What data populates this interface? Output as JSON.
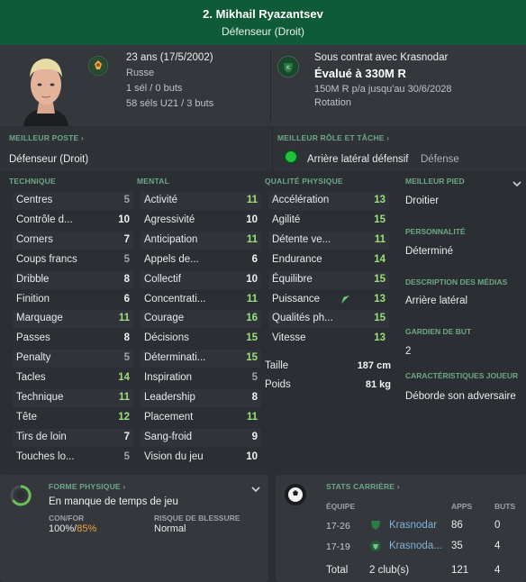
{
  "header": {
    "name": "2. Mikhail Ryazantsev",
    "position": "Défenseur (Droit)"
  },
  "bio": {
    "age": "23 ans (17/5/2002)",
    "nationality": "Russe",
    "caps": "1 sél / 0 buts",
    "u21_caps": "58 séls U21 / 3 buts",
    "contract": "Sous contrat avec Krasnodar",
    "value": "Évalué à 330M R",
    "wage": "150M R p/a jusqu'au 30/6/2028",
    "squad_status": "Rotation"
  },
  "best_position": {
    "label": "MEILLEUR POSTE",
    "value": "Défenseur (Droit)"
  },
  "best_role": {
    "label": "MEILLEUR RÔLE ET TÂCHE",
    "role": "Arrière latéral défensif",
    "duty": "Défense"
  },
  "technique": {
    "label": "TECHNIQUE",
    "items": [
      {
        "name": "Centres",
        "value": "5"
      },
      {
        "name": "Contrôle d...",
        "value": "10"
      },
      {
        "name": "Corners",
        "value": "7"
      },
      {
        "name": "Coups francs",
        "value": "5"
      },
      {
        "name": "Dribble",
        "value": "8"
      },
      {
        "name": "Finition",
        "value": "6"
      },
      {
        "name": "Marquage",
        "value": "11"
      },
      {
        "name": "Passes",
        "value": "8"
      },
      {
        "name": "Penalty",
        "value": "5"
      },
      {
        "name": "Tacles",
        "value": "14"
      },
      {
        "name": "Technique",
        "value": "11"
      },
      {
        "name": "Tête",
        "value": "12"
      },
      {
        "name": "Tirs de loin",
        "value": "7"
      },
      {
        "name": "Touches lo...",
        "value": "5"
      }
    ]
  },
  "mental": {
    "label": "MENTAL",
    "items": [
      {
        "name": "Activité",
        "value": "11"
      },
      {
        "name": "Agressivité",
        "value": "10"
      },
      {
        "name": "Anticipation",
        "value": "11"
      },
      {
        "name": "Appels de...",
        "value": "6"
      },
      {
        "name": "Collectif",
        "value": "10"
      },
      {
        "name": "Concentrati...",
        "value": "11"
      },
      {
        "name": "Courage",
        "value": "16"
      },
      {
        "name": "Décisions",
        "value": "15"
      },
      {
        "name": "Déterminati...",
        "value": "15"
      },
      {
        "name": "Inspiration",
        "value": "5"
      },
      {
        "name": "Leadership",
        "value": "8"
      },
      {
        "name": "Placement",
        "value": "11"
      },
      {
        "name": "Sang-froid",
        "value": "9"
      },
      {
        "name": "Vision du jeu",
        "value": "10"
      }
    ]
  },
  "physical": {
    "label": "QUALITÉ PHYSIQUE",
    "items": [
      {
        "name": "Accélération",
        "value": "13"
      },
      {
        "name": "Agilité",
        "value": "15"
      },
      {
        "name": "Détente ve...",
        "value": "11"
      },
      {
        "name": "Endurance",
        "value": "14"
      },
      {
        "name": "Équilibre",
        "value": "15"
      },
      {
        "name": "Puissance",
        "value": "13"
      },
      {
        "name": "Qualités ph...",
        "value": "15"
      },
      {
        "name": "Vitesse",
        "value": "13"
      }
    ],
    "height_label": "Taille",
    "height": "187 cm",
    "weight_label": "Poids",
    "weight": "81 kg"
  },
  "side": {
    "foot_label": "MEILLEUR PIED",
    "foot": "Droitier",
    "personality_label": "PERSONNALITÉ",
    "personality": "Déterminé",
    "media_label": "DESCRIPTION DES MÉDIAS",
    "media": "Arrière latéral",
    "gk_label": "GARDIEN DE BUT",
    "gk": "2",
    "traits_label": "CARACTÉRISTIQUES JOUEUR",
    "traits": "Déborde son adversaire"
  },
  "fitness": {
    "label": "FORME PHYSIQUE",
    "status": "En manque de temps de jeu",
    "cond_label": "CON/FOR",
    "cond_value": "100%/",
    "form_value": "85%",
    "injury_label": "RISQUE DE BLESSURE",
    "injury": "Normal"
  },
  "career": {
    "label": "STATS CARRIÈRE",
    "headers": {
      "team": "ÉQUIPE",
      "apps": "APPS",
      "goals": "BUTS"
    },
    "rows": [
      {
        "season": "17-26",
        "team": "Krasnodar",
        "apps": "86",
        "goals": "0"
      },
      {
        "season": "17-19",
        "team": "Krasnoda...",
        "apps": "35",
        "goals": "4"
      }
    ],
    "total_label": "Total",
    "total_clubs": "2 club(s)",
    "total_apps": "121",
    "total_goals": "4"
  },
  "colors": {
    "header_bg": "#0e5a39",
    "value_green": "#9be07a",
    "value_white": "#f2f3f4",
    "value_grey": "#a0a4a8",
    "section_label": "#6fa688",
    "form_orange": "#f0a23a"
  }
}
